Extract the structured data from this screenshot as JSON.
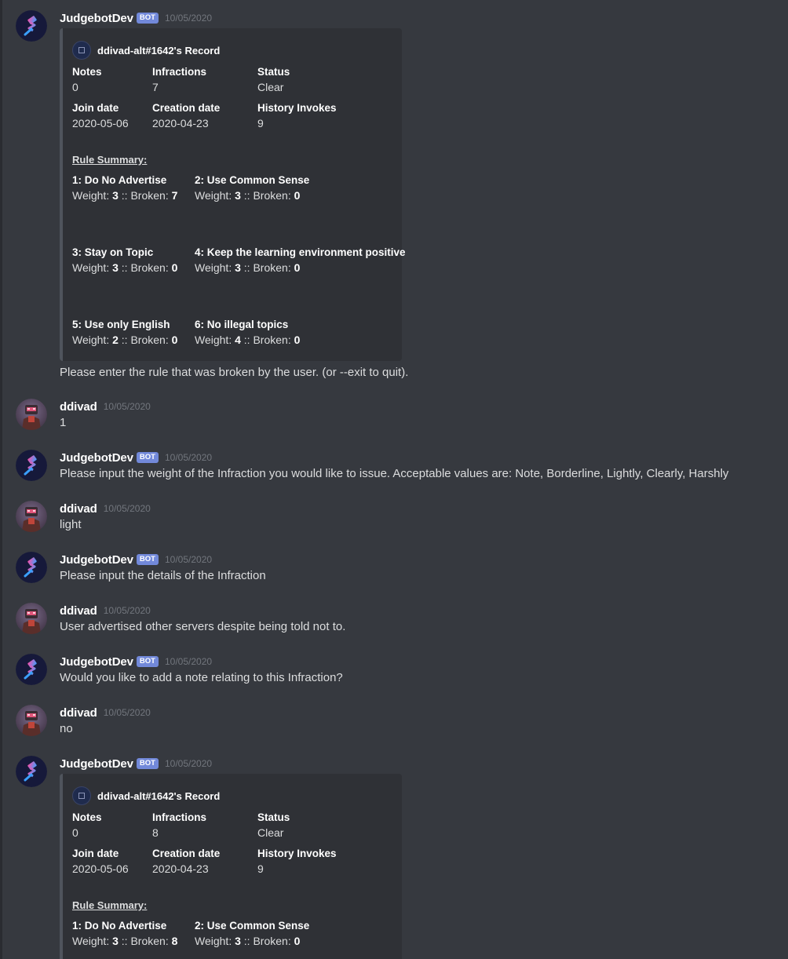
{
  "bot_name": "JudgebotDev",
  "bot_tag": "BOT",
  "user_name": "ddivad",
  "date": "10/05/2020",
  "embed1": {
    "author": "ddivad-alt#1642's Record",
    "fields": {
      "notes_label": "Notes",
      "notes_value": "0",
      "infractions_label": "Infractions",
      "infractions_value": "7",
      "status_label": "Status",
      "status_value": "Clear",
      "join_label": "Join date",
      "join_value": "2020-05-06",
      "creation_label": "Creation date",
      "creation_value": "2020-04-23",
      "history_label": "History Invokes",
      "history_value": "9"
    },
    "rule_summary_label": "Rule Summary:",
    "rules": [
      {
        "title": "1: Do No Advertise",
        "weight": "3",
        "broken": "7"
      },
      {
        "title": "2: Use Common Sense",
        "weight": "3",
        "broken": "0"
      },
      {
        "title": "3: Stay on Topic",
        "weight": "3",
        "broken": "0"
      },
      {
        "title": "4: Keep the learning environment positive",
        "weight": "3",
        "broken": "0"
      },
      {
        "title": "5: Use only English",
        "weight": "2",
        "broken": "0"
      },
      {
        "title": "6: No illegal topics",
        "weight": "4",
        "broken": "0"
      }
    ],
    "weight_label": "Weight:",
    "broken_label": ":: Broken:"
  },
  "messages": {
    "m1_text": "Please enter the rule that was broken by the user. (or --exit to quit).",
    "m2_text": "1",
    "m3_text": "Please input the weight of the Infraction you would like to issue. Acceptable values are: Note, Borderline, Lightly, Clearly, Harshly",
    "m4_text": "light",
    "m5_text": "Please input the details of the Infraction",
    "m6_text": "User advertised other servers despite being told not to.",
    "m7_text": "Would you like to add a note relating to this Infraction?",
    "m8_text": "no"
  },
  "embed2": {
    "author": "ddivad-alt#1642's Record",
    "fields": {
      "notes_label": "Notes",
      "notes_value": "0",
      "infractions_label": "Infractions",
      "infractions_value": "8",
      "status_label": "Status",
      "status_value": "Clear",
      "join_label": "Join date",
      "join_value": "2020-05-06",
      "creation_label": "Creation date",
      "creation_value": "2020-04-23",
      "history_label": "History Invokes",
      "history_value": "9"
    },
    "rule_summary_label": "Rule Summary:",
    "rules": [
      {
        "title": "1: Do No Advertise",
        "weight": "3",
        "broken": "8"
      },
      {
        "title": "2: Use Common Sense",
        "weight": "3",
        "broken": "0"
      }
    ],
    "weight_label": "Weight:",
    "broken_label": ":: Broken:"
  },
  "colors": {
    "background": "#36393f",
    "embed_bg": "#2f3136",
    "embed_border": "#4f545c",
    "bot_tag": "#7289da",
    "timestamp": "#72767d"
  },
  "icons": {
    "bot_avatar": "judgebot-gavel-icon",
    "user_avatar": "user-portrait-icon"
  }
}
